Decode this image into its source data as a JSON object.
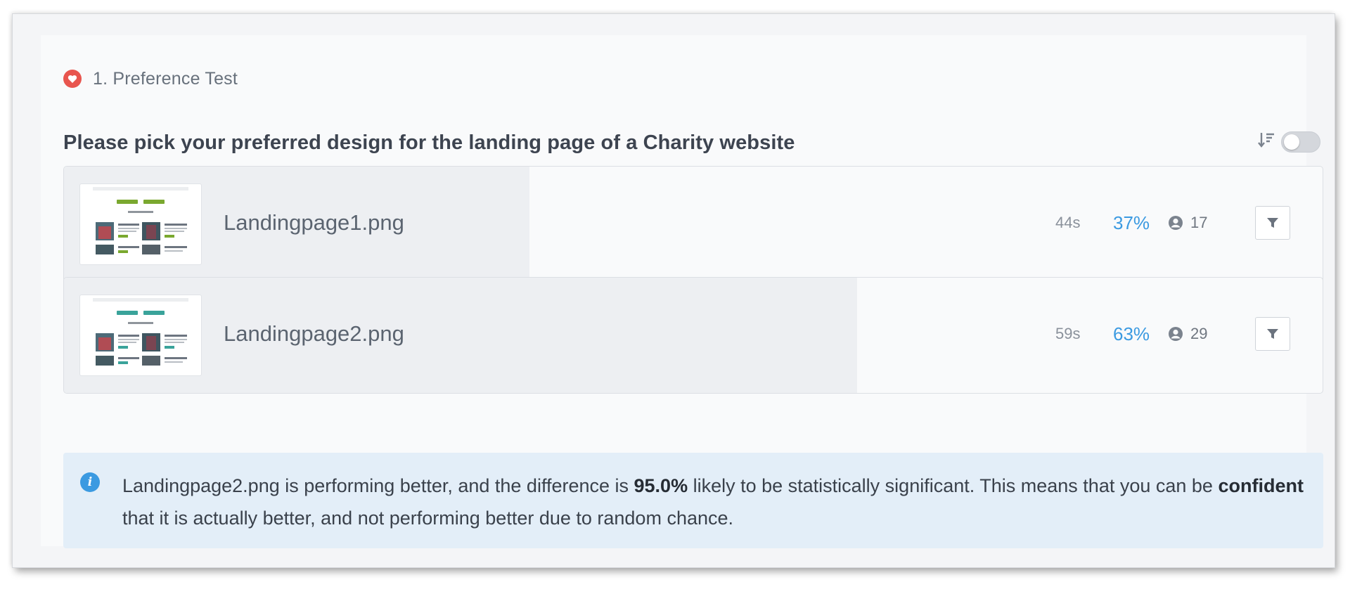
{
  "section": {
    "number_title": "1. Preference Test",
    "icon": "heart-icon",
    "accent": "#e8554e"
  },
  "question": "Please pick your preferred design for the landing page of a Charity website",
  "sort_toggle": {
    "icon": "sort-descending-icon",
    "state": "off"
  },
  "options": [
    {
      "filename": "Landingpage1.png",
      "time": "44s",
      "percent": "37%",
      "share": 0.37,
      "respondents": "17",
      "thumbnail_button_color": "#7aa82f"
    },
    {
      "filename": "Landingpage2.png",
      "time": "59s",
      "percent": "63%",
      "share": 0.63,
      "respondents": "29",
      "thumbnail_button_color": "#3aa39a"
    }
  ],
  "insight": {
    "text_1": "Landingpage2.png is performing better, and the difference is ",
    "bold_1": "95.0%",
    "text_2": " likely to be statistically significant. This means that you can be ",
    "bold_2": "confident",
    "text_3": " that it is actually better, and not performing better due to random chance.",
    "icon": "info-icon"
  },
  "colors": {
    "percent": "#3b9ae1",
    "info_background": "#e3eef8"
  }
}
